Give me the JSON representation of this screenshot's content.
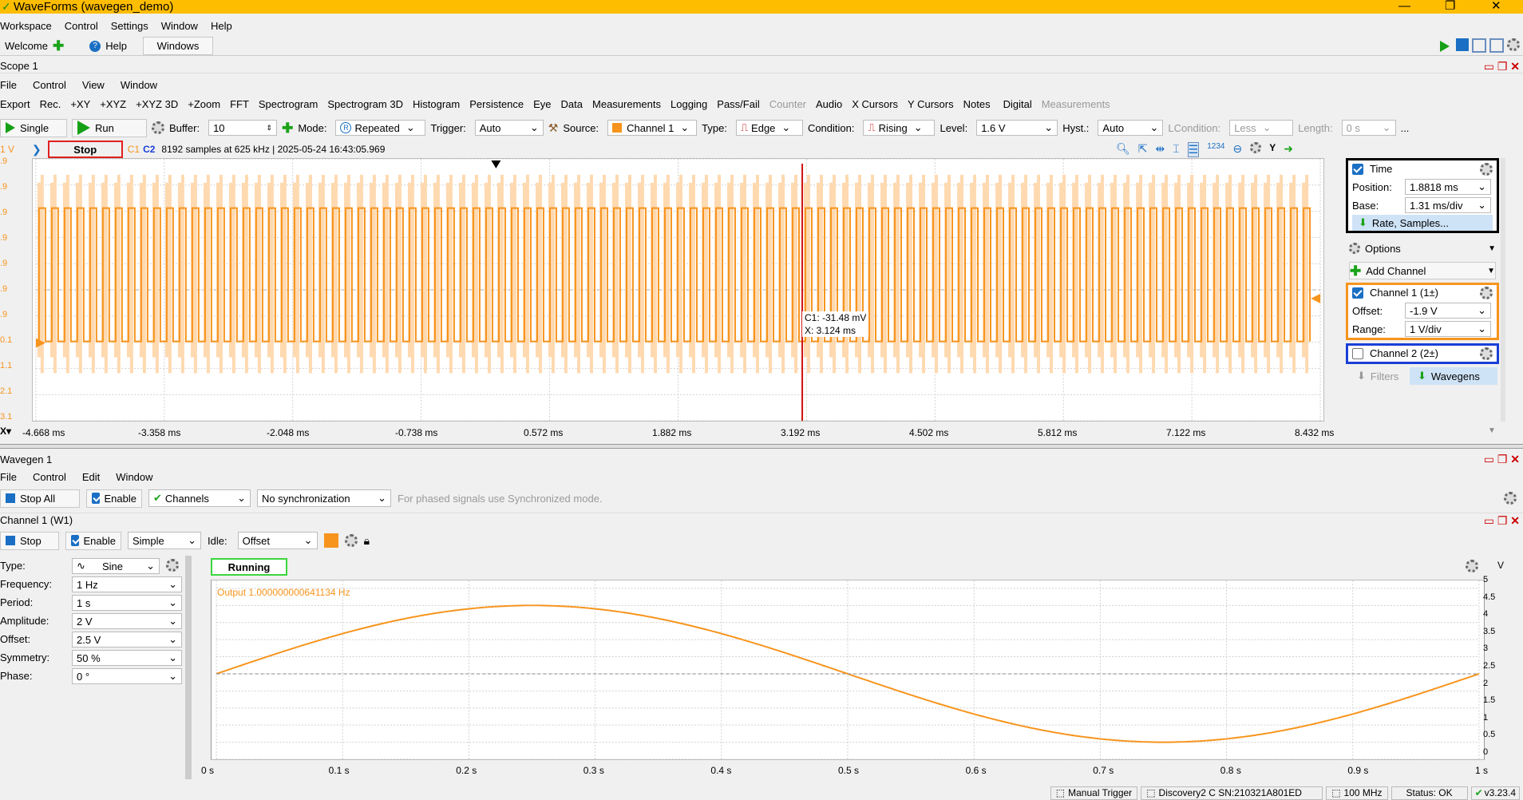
{
  "window": {
    "title": "WaveForms (wavegen_demo)",
    "min": "—",
    "max": "❐",
    "close": "✕"
  },
  "app_menu": [
    "Workspace",
    "Control",
    "Settings",
    "Window",
    "Help"
  ],
  "tabs": {
    "welcome": "Welcome",
    "help": "Help",
    "windows": "Windows"
  },
  "scope": {
    "title": "Scope 1",
    "menu": [
      "File",
      "Control",
      "View",
      "Window"
    ],
    "toolbar": [
      "Export",
      "Rec.",
      "+XY",
      "+XYZ",
      "+XYZ 3D",
      "+Zoom",
      "FFT",
      "Spectrogram",
      "Spectrogram 3D",
      "Histogram",
      "Persistence",
      "Eye",
      "Data",
      "Measurements",
      "Logging",
      "Pass/Fail",
      "Counter",
      "Audio",
      "X Cursors",
      "Y Cursors",
      "Notes",
      "Digital",
      "Measurements"
    ],
    "controls": {
      "single": "Single",
      "run": "Run",
      "buffer_label": "Buffer:",
      "buffer": "10",
      "mode_label": "Mode:",
      "mode": "Repeated",
      "trigger_label": "Trigger:",
      "trigger": "Auto",
      "source_label": "Source:",
      "source": "Channel 1",
      "type_label": "Type:",
      "type": "Edge",
      "condition_label": "Condition:",
      "condition": "Rising",
      "level_label": "Level:",
      "level": "1.6 V",
      "hyst_label": "Hyst.:",
      "hyst": "Auto",
      "lcondition_label": "LCondition:",
      "lcondition": "Less",
      "length_label": "Length:",
      "length": "0 s",
      "more": "..."
    },
    "status": {
      "unit": "1 V",
      "stop": "Stop",
      "c1": "C1",
      "c2": "C2",
      "info": "8192 samples at 625 kHz  | 2025-05-24 16:43:05.969",
      "y": "Y"
    },
    "y_ticks": [
      ".9",
      ".9",
      ".9",
      ".9",
      ".9",
      ".9",
      ".9",
      "0.1",
      "1.1",
      "2.1",
      "3.1"
    ],
    "x_ticks": [
      "-4.668 ms",
      "-3.358 ms",
      "-2.048 ms",
      "-0.738 ms",
      "0.572 ms",
      "1.882 ms",
      "3.192 ms",
      "4.502 ms",
      "5.812 ms",
      "7.122 ms",
      "8.432 ms"
    ],
    "cursor_readout": {
      "c1": "C1: -31.48 mV",
      "x": "X: 3.124 ms"
    },
    "right_panel": {
      "time": "Time",
      "position_label": "Position:",
      "position": "1.8818 ms",
      "base_label": "Base:",
      "base": "1.31 ms/div",
      "rate": "Rate, Samples...",
      "options": "Options",
      "add_channel": "Add Channel",
      "ch1": "Channel 1 (1±)",
      "offset_label": "Offset:",
      "offset": "-1.9 V",
      "range_label": "Range:",
      "range": "1 V/div",
      "ch2": "Channel 2 (2±)",
      "filters": "Filters",
      "wavegens": "Wavegens"
    },
    "colors": {
      "ch1": "#f7941d",
      "ch2": "#1a3fd6",
      "time_box": "#000000"
    }
  },
  "wavegen": {
    "title": "Wavegen 1",
    "menu": [
      "File",
      "Control",
      "Edit",
      "Window"
    ],
    "stop_all": "Stop All",
    "enable": "Enable",
    "channels": "Channels",
    "sync": "No synchronization",
    "hint": "For phased signals use Synchronized mode.",
    "channel_title": "Channel 1 (W1)",
    "stop": "Stop",
    "mode": "Simple",
    "idle_label": "Idle:",
    "idle": "Offset",
    "params": [
      {
        "label": "Type:",
        "value": "Sine"
      },
      {
        "label": "Frequency:",
        "value": "1 Hz"
      },
      {
        "label": "Period:",
        "value": "1 s"
      },
      {
        "label": "Amplitude:",
        "value": "2 V"
      },
      {
        "label": "Offset:",
        "value": "2.5 V"
      },
      {
        "label": "Symmetry:",
        "value": "50 %"
      },
      {
        "label": "Phase:",
        "value": "0 °"
      }
    ],
    "running": "Running",
    "output": "Output 1.000000000641134 Hz",
    "y_unit": "V",
    "y_ticks": [
      "5",
      "4.5",
      "4",
      "3.5",
      "3",
      "2.5",
      "2",
      "1.5",
      "1",
      "0.5",
      "0"
    ],
    "x_ticks": [
      "0 s",
      "0.1 s",
      "0.2 s",
      "0.3 s",
      "0.4 s",
      "0.5 s",
      "0.6 s",
      "0.7 s",
      "0.8 s",
      "0.9 s",
      "1 s"
    ]
  },
  "statusbar": {
    "manual": "Manual Trigger",
    "device": "Discovery2 C SN:210321A801ED",
    "clock": "100 MHz",
    "status": "Status: OK",
    "version": "v3.23.4"
  }
}
